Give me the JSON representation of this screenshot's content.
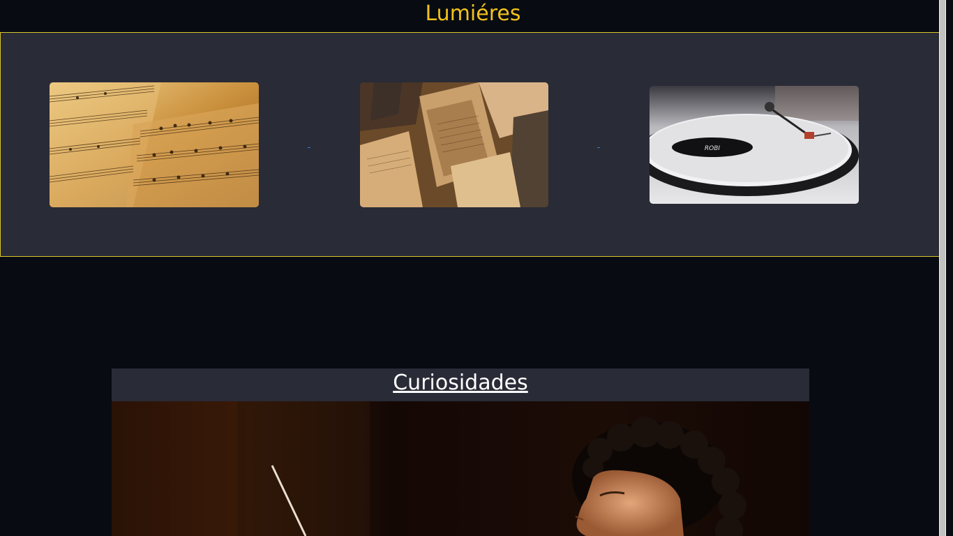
{
  "header": {
    "title": "Lumiéres"
  },
  "gallery": {
    "items": [
      {
        "image": "sheet-music-image"
      },
      {
        "image": "old-manuscripts-image"
      },
      {
        "image": "vinyl-turntable-image"
      }
    ]
  },
  "curiosities": {
    "title": "Curiosidades",
    "image": "conductor-image"
  },
  "colors": {
    "background": "#080b12",
    "panel": "#292b36",
    "title": "#f2c21b",
    "border": "#d8c52a",
    "link": "#3a7bd5"
  }
}
